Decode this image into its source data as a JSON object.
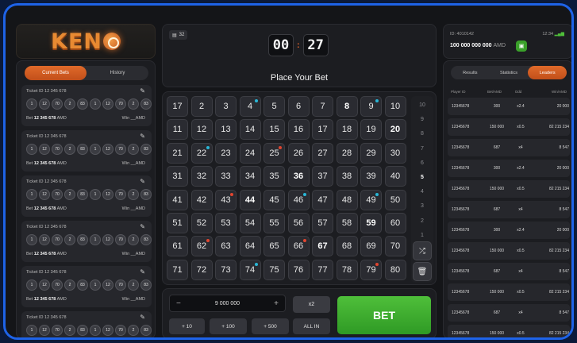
{
  "logo": {
    "text": "KEN"
  },
  "left": {
    "tabs": [
      "Current Bets",
      "History"
    ],
    "tickets": [
      {
        "id": "Ticket ID 12 345 678",
        "balls": [
          "1",
          "12",
          "70",
          "2",
          "83",
          "1",
          "12",
          "70",
          "2",
          "83"
        ],
        "bet_label": "Bet",
        "bet_value": "12 345 678",
        "currency": "AMD",
        "win": "Win __AMD"
      },
      {
        "id": "Ticket ID 12 345 678",
        "balls": [
          "1",
          "12",
          "70",
          "2",
          "83",
          "1",
          "12",
          "70",
          "2",
          "83"
        ],
        "bet_label": "Bet",
        "bet_value": "12 345 678",
        "currency": "AMD",
        "win": "Win __AMD"
      },
      {
        "id": "Ticket ID 12 345 678",
        "balls": [
          "1",
          "12",
          "70",
          "2",
          "83",
          "1",
          "12",
          "70",
          "2",
          "83"
        ],
        "bet_label": "Bet",
        "bet_value": "12 345 678",
        "currency": "AMD",
        "win": "Win __AMD"
      },
      {
        "id": "Ticket ID 12 345 678",
        "balls": [
          "1",
          "12",
          "70",
          "2",
          "83",
          "1",
          "12",
          "70",
          "2",
          "83"
        ],
        "bet_label": "Bet",
        "bet_value": "12 345 678",
        "currency": "AMD",
        "win": "Win __AMD"
      },
      {
        "id": "Ticket ID 12 345 678",
        "balls": [
          "1",
          "12",
          "70",
          "2",
          "83",
          "1",
          "12",
          "70",
          "2",
          "83"
        ],
        "bet_label": "Bet",
        "bet_value": "12 345 678",
        "currency": "AMD",
        "win": "Win __AMD"
      },
      {
        "id": "Ticket ID 12 345 678",
        "balls": [
          "1",
          "12",
          "70",
          "2",
          "83",
          "1",
          "12",
          "70",
          "2",
          "83"
        ],
        "bet_label": "Bet",
        "bet_value": "12 345 678",
        "currency": "AMD",
        "win": "Win __AMD"
      }
    ]
  },
  "timer": {
    "badge": "32",
    "minutes": "00",
    "seconds": "27",
    "status": "Place Your Bet"
  },
  "grid": {
    "numbers": [
      {
        "n": "17",
        "b": 0,
        "d": ""
      },
      {
        "n": "2",
        "b": 0,
        "d": ""
      },
      {
        "n": "3",
        "b": 0,
        "d": ""
      },
      {
        "n": "4",
        "b": 0,
        "d": "b"
      },
      {
        "n": "5",
        "b": 0,
        "d": ""
      },
      {
        "n": "6",
        "b": 0,
        "d": ""
      },
      {
        "n": "7",
        "b": 0,
        "d": ""
      },
      {
        "n": "8",
        "b": 1,
        "d": ""
      },
      {
        "n": "9",
        "b": 0,
        "d": "b"
      },
      {
        "n": "10",
        "b": 0,
        "d": ""
      },
      {
        "n": "11",
        "b": 0,
        "d": ""
      },
      {
        "n": "12",
        "b": 0,
        "d": ""
      },
      {
        "n": "13",
        "b": 0,
        "d": ""
      },
      {
        "n": "14",
        "b": 0,
        "d": ""
      },
      {
        "n": "15",
        "b": 0,
        "d": ""
      },
      {
        "n": "16",
        "b": 0,
        "d": ""
      },
      {
        "n": "17",
        "b": 0,
        "d": ""
      },
      {
        "n": "18",
        "b": 0,
        "d": ""
      },
      {
        "n": "19",
        "b": 0,
        "d": ""
      },
      {
        "n": "20",
        "b": 1,
        "d": ""
      },
      {
        "n": "21",
        "b": 0,
        "d": ""
      },
      {
        "n": "22",
        "b": 0,
        "d": "b"
      },
      {
        "n": "23",
        "b": 0,
        "d": ""
      },
      {
        "n": "24",
        "b": 0,
        "d": ""
      },
      {
        "n": "25",
        "b": 0,
        "d": "r"
      },
      {
        "n": "26",
        "b": 0,
        "d": ""
      },
      {
        "n": "27",
        "b": 0,
        "d": ""
      },
      {
        "n": "28",
        "b": 0,
        "d": ""
      },
      {
        "n": "29",
        "b": 0,
        "d": ""
      },
      {
        "n": "30",
        "b": 0,
        "d": ""
      },
      {
        "n": "31",
        "b": 0,
        "d": ""
      },
      {
        "n": "32",
        "b": 0,
        "d": ""
      },
      {
        "n": "33",
        "b": 0,
        "d": ""
      },
      {
        "n": "34",
        "b": 0,
        "d": ""
      },
      {
        "n": "35",
        "b": 0,
        "d": ""
      },
      {
        "n": "36",
        "b": 1,
        "d": ""
      },
      {
        "n": "37",
        "b": 0,
        "d": ""
      },
      {
        "n": "38",
        "b": 0,
        "d": ""
      },
      {
        "n": "39",
        "b": 0,
        "d": ""
      },
      {
        "n": "40",
        "b": 0,
        "d": ""
      },
      {
        "n": "41",
        "b": 0,
        "d": ""
      },
      {
        "n": "42",
        "b": 0,
        "d": ""
      },
      {
        "n": "43",
        "b": 0,
        "d": "r"
      },
      {
        "n": "44",
        "b": 1,
        "d": ""
      },
      {
        "n": "45",
        "b": 0,
        "d": ""
      },
      {
        "n": "46",
        "b": 0,
        "d": "b"
      },
      {
        "n": "47",
        "b": 0,
        "d": ""
      },
      {
        "n": "48",
        "b": 0,
        "d": ""
      },
      {
        "n": "49",
        "b": 0,
        "d": "b"
      },
      {
        "n": "50",
        "b": 0,
        "d": ""
      },
      {
        "n": "51",
        "b": 0,
        "d": ""
      },
      {
        "n": "52",
        "b": 0,
        "d": ""
      },
      {
        "n": "53",
        "b": 0,
        "d": ""
      },
      {
        "n": "54",
        "b": 0,
        "d": ""
      },
      {
        "n": "55",
        "b": 0,
        "d": ""
      },
      {
        "n": "56",
        "b": 0,
        "d": ""
      },
      {
        "n": "57",
        "b": 0,
        "d": ""
      },
      {
        "n": "58",
        "b": 0,
        "d": ""
      },
      {
        "n": "59",
        "b": 1,
        "d": ""
      },
      {
        "n": "60",
        "b": 0,
        "d": ""
      },
      {
        "n": "61",
        "b": 0,
        "d": ""
      },
      {
        "n": "62",
        "b": 0,
        "d": "r"
      },
      {
        "n": "63",
        "b": 0,
        "d": ""
      },
      {
        "n": "64",
        "b": 0,
        "d": ""
      },
      {
        "n": "65",
        "b": 0,
        "d": ""
      },
      {
        "n": "66",
        "b": 0,
        "d": "r"
      },
      {
        "n": "67",
        "b": 1,
        "d": ""
      },
      {
        "n": "68",
        "b": 0,
        "d": ""
      },
      {
        "n": "69",
        "b": 0,
        "d": ""
      },
      {
        "n": "70",
        "b": 0,
        "d": ""
      },
      {
        "n": "71",
        "b": 0,
        "d": ""
      },
      {
        "n": "72",
        "b": 0,
        "d": ""
      },
      {
        "n": "73",
        "b": 0,
        "d": ""
      },
      {
        "n": "74",
        "b": 0,
        "d": "b"
      },
      {
        "n": "75",
        "b": 0,
        "d": ""
      },
      {
        "n": "76",
        "b": 0,
        "d": ""
      },
      {
        "n": "77",
        "b": 0,
        "d": ""
      },
      {
        "n": "78",
        "b": 0,
        "d": ""
      },
      {
        "n": "79",
        "b": 0,
        "d": "r"
      },
      {
        "n": "80",
        "b": 0,
        "d": ""
      }
    ],
    "scale": [
      "10",
      "9",
      "8",
      "7",
      "6",
      "5",
      "4",
      "3",
      "2",
      "1"
    ],
    "scale_highlight": "5"
  },
  "bet": {
    "minus": "−",
    "plus": "+",
    "amount": "9 000 000",
    "x2": "x2",
    "quick": [
      "+ 10",
      "+ 100",
      "+ 500",
      "ALL IN"
    ],
    "bet_label": "BET"
  },
  "account": {
    "id": "ID: 4010142",
    "time": "12:34",
    "balance": "100 000 000 000",
    "currency": "AMD"
  },
  "right": {
    "tabs": [
      "Results",
      "Statistics",
      "Leaders"
    ],
    "headers": [
      "Player ID",
      "Bet/AMD",
      "Odd",
      "Win/AMD"
    ],
    "rows": [
      [
        "12345678",
        "300",
        "x2.4",
        "20 000"
      ],
      [
        "12345678",
        "150 000",
        "x0.5",
        "82 215 234"
      ],
      [
        "12345678",
        "687",
        "x4",
        "8 547"
      ],
      [
        "12345678",
        "300",
        "x2.4",
        "20 000"
      ],
      [
        "12345678",
        "150 000",
        "x0.5",
        "82 215 234"
      ],
      [
        "12345678",
        "687",
        "x4",
        "8 547"
      ],
      [
        "12345678",
        "300",
        "x2.4",
        "20 000"
      ],
      [
        "12345678",
        "150 000",
        "x0.5",
        "82 215 234"
      ],
      [
        "12345678",
        "687",
        "x4",
        "8 547"
      ],
      [
        "12345678",
        "150 000",
        "x0.5",
        "82 215 234"
      ],
      [
        "12345678",
        "687",
        "x4",
        "8 547"
      ],
      [
        "12345678",
        "150 000",
        "x0.5",
        "82 215 234"
      ]
    ]
  },
  "colors": {
    "accent": "#e0622a",
    "frame": "#1e63e8",
    "bet": "#3fae30",
    "dot_blue": "#29b6d6",
    "dot_red": "#e0452f"
  }
}
